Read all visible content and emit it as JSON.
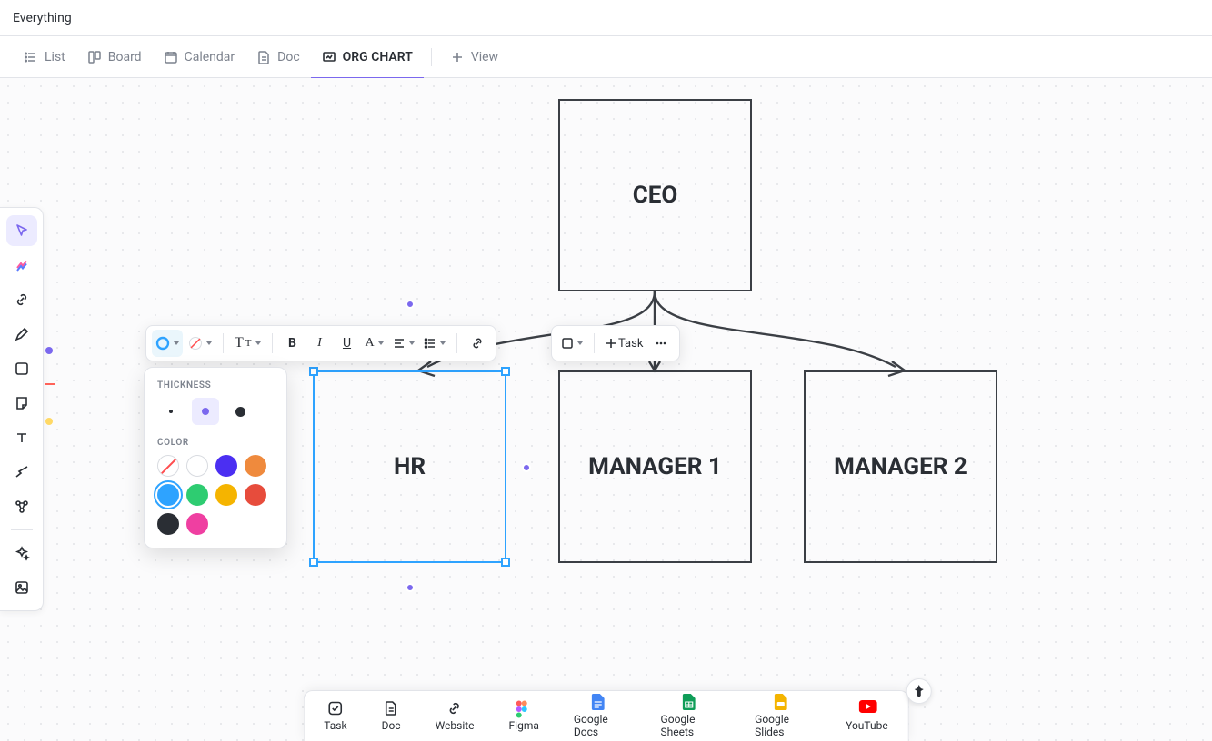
{
  "title": "Everything",
  "tabs": {
    "list": "List",
    "board": "Board",
    "calendar": "Calendar",
    "doc": "Doc",
    "orgchart": "ORG CHART",
    "addview": "View"
  },
  "nodes": {
    "ceo": "CEO",
    "hr": "HR",
    "m1": "MANAGER 1",
    "m2": "MANAGER 2"
  },
  "fmt": {
    "task": "Task"
  },
  "popover": {
    "thickness": "THICKNESS",
    "color": "COLOR",
    "colors": {
      "none": "#ffffff",
      "white": "#ffffff",
      "blue": "#4b2ff2",
      "orange": "#ef8a3d",
      "teal": "#2ea3ff",
      "green": "#2ecc71",
      "yellow": "#f5b400",
      "red": "#e74c3c",
      "dark": "#2a2e34",
      "pink": "#ef3fa1"
    }
  },
  "bottom": {
    "task": "Task",
    "doc": "Doc",
    "website": "Website",
    "figma": "Figma",
    "gdocs": "Google Docs",
    "gsheets": "Google Sheets",
    "gslides": "Google Slides",
    "youtube": "YouTube"
  },
  "tool_dots": {
    "purple": "#7b68ee",
    "red": "#ff6359",
    "yellow": "#ffd966"
  }
}
